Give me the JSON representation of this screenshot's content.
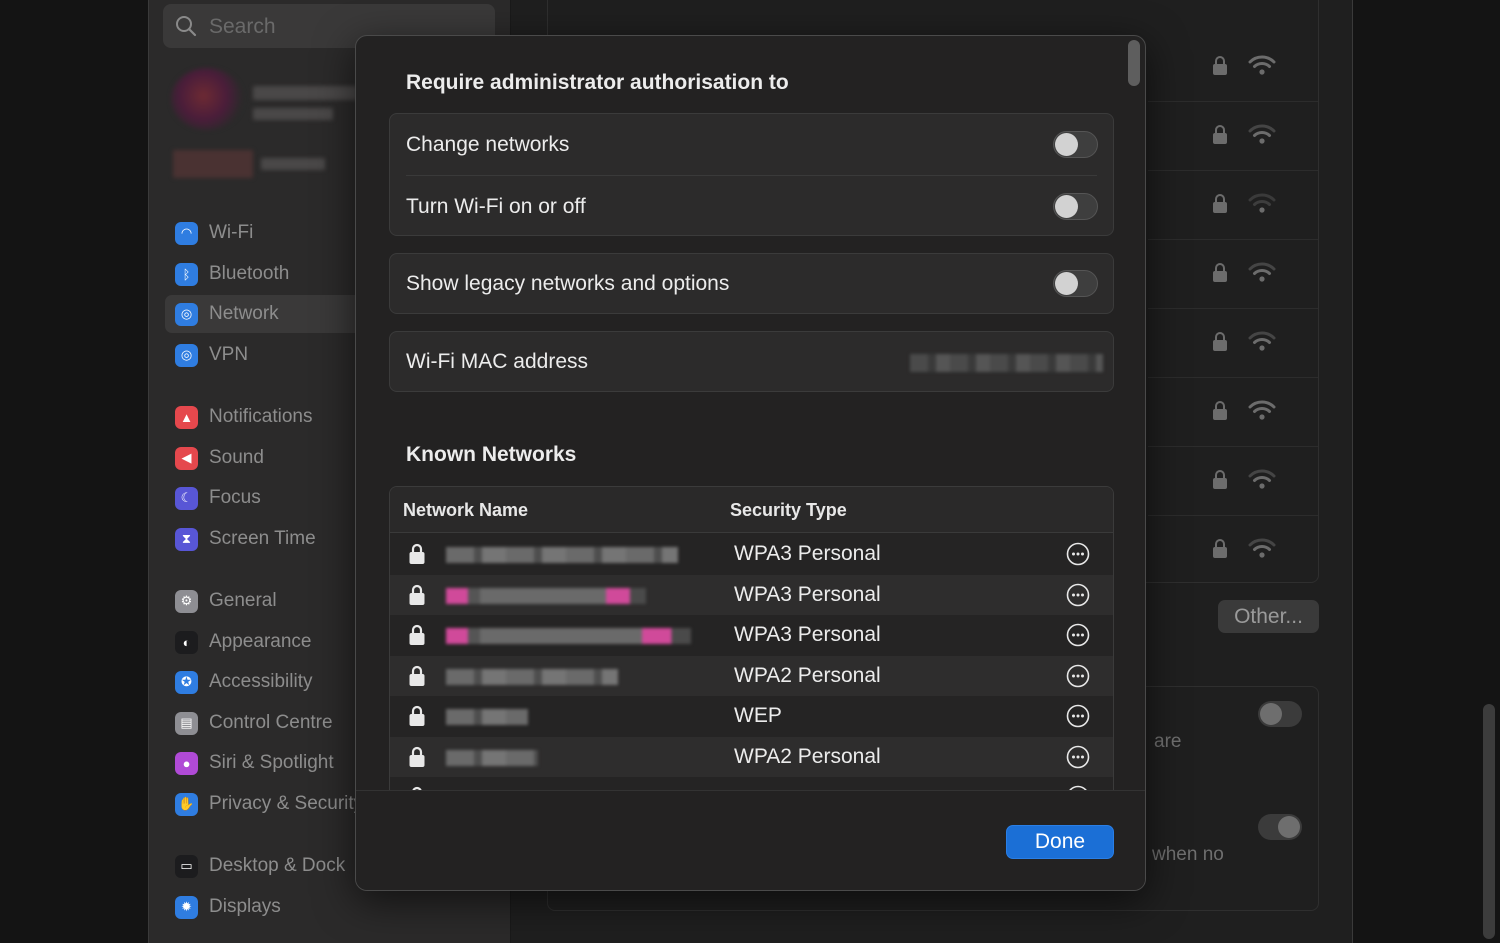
{
  "search": {
    "placeholder": "Search"
  },
  "sidebar": {
    "items": [
      {
        "label": "Wi-Fi",
        "icon": "wifi-icon",
        "color": "#2f7de1"
      },
      {
        "label": "Bluetooth",
        "icon": "bluetooth-icon",
        "color": "#2f7de1"
      },
      {
        "label": "Network",
        "icon": "globe-icon",
        "color": "#2f7de1",
        "selected": true
      },
      {
        "label": "VPN",
        "icon": "globe-icon",
        "color": "#2f7de1"
      },
      {
        "label": "Notifications",
        "icon": "bell-icon",
        "color": "#e5484d"
      },
      {
        "label": "Sound",
        "icon": "speaker-icon",
        "color": "#e5484d"
      },
      {
        "label": "Focus",
        "icon": "moon-icon",
        "color": "#5856d6"
      },
      {
        "label": "Screen Time",
        "icon": "hourglass-icon",
        "color": "#5856d6"
      },
      {
        "label": "General",
        "icon": "gear-icon",
        "color": "#8e8e93"
      },
      {
        "label": "Appearance",
        "icon": "appearance-icon",
        "color": "#1c1c1e"
      },
      {
        "label": "Accessibility",
        "icon": "accessibility-icon",
        "color": "#2f7de1"
      },
      {
        "label": "Control Centre",
        "icon": "control-centre-icon",
        "color": "#8e8e93"
      },
      {
        "label": "Siri & Spotlight",
        "icon": "siri-icon",
        "color": "#b04ad6"
      },
      {
        "label": "Privacy & Security",
        "icon": "hand-icon",
        "color": "#2f7de1"
      },
      {
        "label": "Desktop & Dock",
        "icon": "dock-icon",
        "color": "#1c1c1e"
      },
      {
        "label": "Displays",
        "icon": "sun-icon",
        "color": "#2f7de1"
      }
    ]
  },
  "main": {
    "other_button": "Other...",
    "bg_text_1": "are",
    "bg_text_2": "when no"
  },
  "sheet": {
    "title": "Require administrator authorisation to",
    "options": [
      {
        "label": "Change networks",
        "on": false
      },
      {
        "label": "Turn Wi-Fi on or off",
        "on": false
      }
    ],
    "legacy": {
      "label": "Show legacy networks and options",
      "on": false
    },
    "mac": {
      "label": "Wi-Fi MAC address"
    },
    "known_title": "Known Networks",
    "columns": [
      "Network Name",
      "Security Type"
    ],
    "rows": [
      {
        "security": "WPA3 Personal"
      },
      {
        "security": "WPA3 Personal"
      },
      {
        "security": "WPA3 Personal"
      },
      {
        "security": "WPA2 Personal"
      },
      {
        "security": "WEP"
      },
      {
        "security": "WPA2 Personal"
      }
    ],
    "done_label": "Done",
    "accent": "#1b6fd6"
  }
}
